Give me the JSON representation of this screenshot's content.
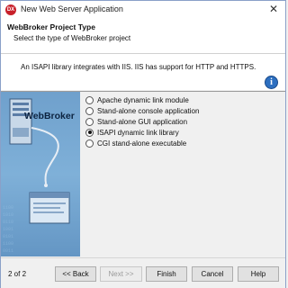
{
  "window": {
    "title": "New Web Server Application",
    "icon_text": "DX"
  },
  "header": {
    "title": "WebBroker Project Type",
    "subtitle": "Select the type of WebBroker project"
  },
  "info": {
    "text": "An ISAPI library integrates with IIS. IIS has support for HTTP and HTTPS."
  },
  "artwork": {
    "label": "WebBroker"
  },
  "options": [
    {
      "label": "Apache dynamic link module",
      "selected": false
    },
    {
      "label": "Stand-alone console application",
      "selected": false
    },
    {
      "label": "Stand-alone GUI application",
      "selected": false
    },
    {
      "label": "ISAPI dynamic link library",
      "selected": true
    },
    {
      "label": "CGI stand-alone executable",
      "selected": false
    }
  ],
  "footer": {
    "page_indicator": "2 of 2",
    "back_label": "<< Back",
    "next_label": "Next >>",
    "finish_label": "Finish",
    "cancel_label": "Cancel",
    "help_label": "Help"
  }
}
